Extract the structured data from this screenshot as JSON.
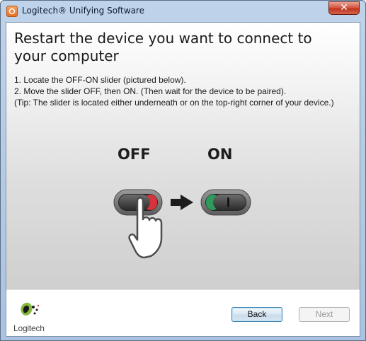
{
  "window": {
    "title": "Logitech® Unifying Software",
    "close_glyph": "✕"
  },
  "page": {
    "heading": "Restart the device you want to connect to your computer",
    "steps": [
      "1. Locate the OFF-ON slider (pictured below).",
      "2. Move the slider OFF, then ON. (Then wait for the device to be paired)."
    ],
    "tip": "(Tip: The slider is located either underneath or on the top-right corner of your device.)"
  },
  "illustration": {
    "off_label": "OFF",
    "on_label": "ON",
    "off_indicator_color": "#d6333c",
    "on_indicator_color": "#2e9a5b",
    "icons": [
      "slider-off-icon",
      "arrow-right-icon",
      "hand-pointer-icon",
      "slider-on-icon"
    ]
  },
  "footer": {
    "logo_text": "Logitech",
    "back_label": "Back",
    "next_label": "Next",
    "next_enabled": false
  }
}
